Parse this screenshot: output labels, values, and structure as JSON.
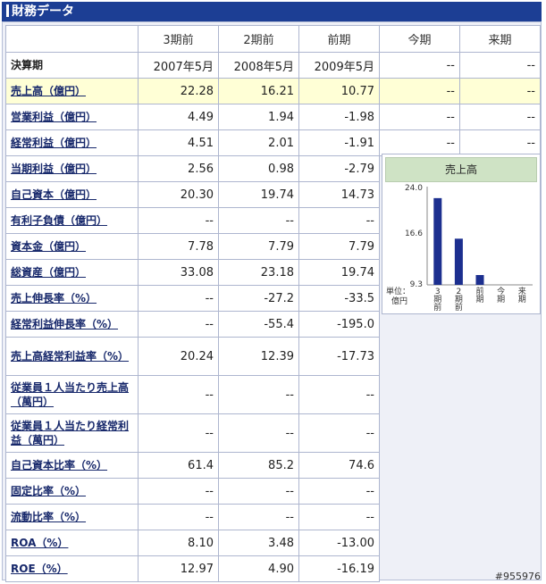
{
  "header": {
    "title": "財務データ"
  },
  "columns": [
    "3期前",
    "2期前",
    "前期",
    "今期",
    "来期"
  ],
  "period_row": {
    "label": "決算期",
    "values": [
      "2007年5月",
      "2008年5月",
      "2009年5月",
      "--",
      "--"
    ]
  },
  "rows": [
    {
      "label": "売上高（億円）",
      "values": [
        "22.28",
        "16.21",
        "10.77",
        "--",
        "--"
      ]
    },
    {
      "label": "営業利益（億円）",
      "values": [
        "4.49",
        "1.94",
        "-1.98",
        "--",
        "--"
      ]
    },
    {
      "label": "経常利益（億円）",
      "values": [
        "4.51",
        "2.01",
        "-1.91",
        "--",
        "--"
      ]
    },
    {
      "label": "当期利益（億円）",
      "values": [
        "2.56",
        "0.98",
        "-2.79"
      ]
    },
    {
      "label": "自己資本（億円）",
      "values": [
        "20.30",
        "19.74",
        "14.73"
      ]
    },
    {
      "label": "有利子負債（億円）",
      "values": [
        "--",
        "--",
        "--"
      ]
    },
    {
      "label": "資本金（億円）",
      "values": [
        "7.78",
        "7.79",
        "7.79"
      ]
    },
    {
      "label": "総資産（億円）",
      "values": [
        "33.08",
        "23.18",
        "19.74"
      ]
    },
    {
      "label": "売上伸長率（%）",
      "values": [
        "--",
        "-27.2",
        "-33.5"
      ]
    },
    {
      "label": "経常利益伸長率（%）",
      "values": [
        "--",
        "-55.4",
        "-195.0"
      ]
    },
    {
      "label": "売上高経常利益率（%）",
      "values": [
        "20.24",
        "12.39",
        "-17.73"
      ]
    },
    {
      "label": "従業員１人当たり売上高（萬円）",
      "values": [
        "--",
        "--",
        "--"
      ]
    },
    {
      "label": "従業員１人当たり経常利益（萬円）",
      "values": [
        "--",
        "--",
        "--"
      ]
    },
    {
      "label": "自己資本比率（%）",
      "values": [
        "61.4",
        "85.2",
        "74.6"
      ]
    },
    {
      "label": "固定比率（%）",
      "values": [
        "--",
        "--",
        "--"
      ]
    },
    {
      "label": "流動比率（%）",
      "values": [
        "--",
        "--",
        "--"
      ]
    },
    {
      "label": "ROA（%）",
      "values": [
        "8.10",
        "3.48",
        "-13.00"
      ]
    },
    {
      "label": "ROE（%）",
      "values": [
        "12.97",
        "4.90",
        "-16.19"
      ]
    }
  ],
  "chart_data": {
    "type": "bar",
    "title": "売上高",
    "categories": [
      "3期前",
      "2期前",
      "前期",
      "今期",
      "来期"
    ],
    "category_labels": [
      "3\n期\n前",
      "2\n期\n前",
      "前\n期",
      "今\n期",
      "来\n期"
    ],
    "values": [
      22.28,
      16.21,
      10.77,
      null,
      null
    ],
    "ylim": [
      9.3,
      24.0
    ],
    "yticks": [
      "24.0",
      "16.6",
      "9.3"
    ],
    "unit_label": "単位：\n億円",
    "bar_color": "#1c2f8f"
  },
  "footer": {
    "code": "#955976"
  }
}
